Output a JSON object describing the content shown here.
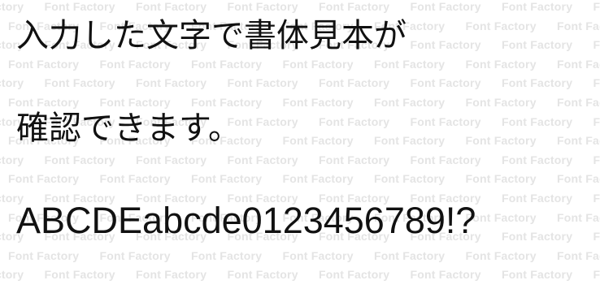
{
  "watermark": {
    "text": "Font Factory"
  },
  "sample": {
    "line1": "入力した文字で書体見本が",
    "line2": "確認できます。",
    "line3": "ABCDEabcde0123456789!?"
  }
}
